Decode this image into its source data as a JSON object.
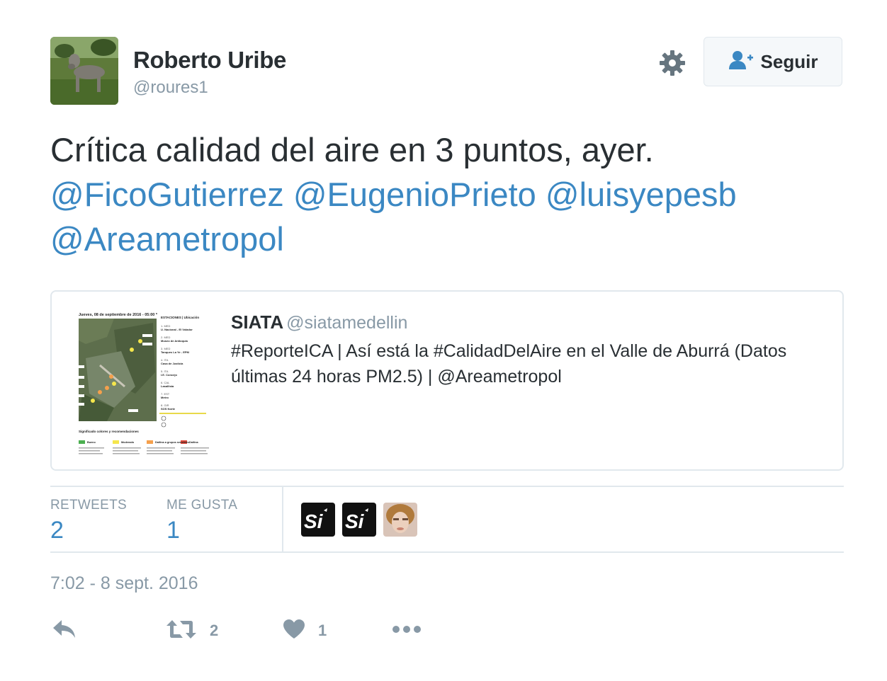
{
  "author": {
    "name": "Roberto Uribe",
    "handle": "@roures1",
    "avatar_icon": "dog-photo"
  },
  "header": {
    "settings_icon": "gear-icon",
    "follow_label": "Seguir",
    "follow_icon": "add-user-icon"
  },
  "tweet": {
    "text": "Crítica calidad del aire en 3 puntos, ayer.",
    "mentions": [
      "@FicoGutierrez",
      "@EugenioPrieto",
      "@luisyepesb",
      "@Areametropol"
    ]
  },
  "quoted": {
    "name": "SIATA",
    "handle": "@siatamedellin",
    "text": "#ReporteICA | Así está la #CalidadDelAire en el Valle de Aburrá (Datos últimas 24 horas PM2.5) | @Areametropol",
    "image": {
      "title": "Jueves, 08 de septiembre de 2016 - 05:00 *",
      "stations_header": "ESTACIONES | Ubicación",
      "stations": [
        {
          "code": "1. MED",
          "place": "U. Nacional - El Volador"
        },
        {
          "code": "2. MED",
          "place": "Museo de Antioquia"
        },
        {
          "code": "3. MED",
          "place": "Tanques La Ye - EPM"
        },
        {
          "code": "4. ITA",
          "place": "Casa de Justicia"
        },
        {
          "code": "5. ITA",
          "place": "I.E. Concejo"
        },
        {
          "code": "6. CAL",
          "place": "Lasallista"
        },
        {
          "code": "7. EST",
          "place": "Metro"
        },
        {
          "code": "8. GIR",
          "place": "SOS Norte"
        }
      ],
      "legend": [
        "Bueno",
        "Moderado",
        "Dañina a grupos sensibles",
        "Dañina"
      ],
      "legend_colors": [
        "#4caf50",
        "#f5e64c",
        "#f5a04c",
        "#e0483a"
      ],
      "section_title": "Significado colores y recomendaciones"
    }
  },
  "stats": {
    "retweets_label": "RETWEETS",
    "retweets": "2",
    "likes_label": "ME GUSTA",
    "likes": "1"
  },
  "timestamp": "7:02 - 8 sept. 2016",
  "actions": {
    "reply_icon": "reply-icon",
    "retweet_icon": "retweet-icon",
    "retweet_count": "2",
    "like_icon": "heart-icon",
    "like_count": "1",
    "more_icon": "more-icon"
  },
  "colors": {
    "link": "#3b88c3",
    "muted": "#8899a6",
    "text": "#292f33",
    "border": "#e1e8ed"
  }
}
